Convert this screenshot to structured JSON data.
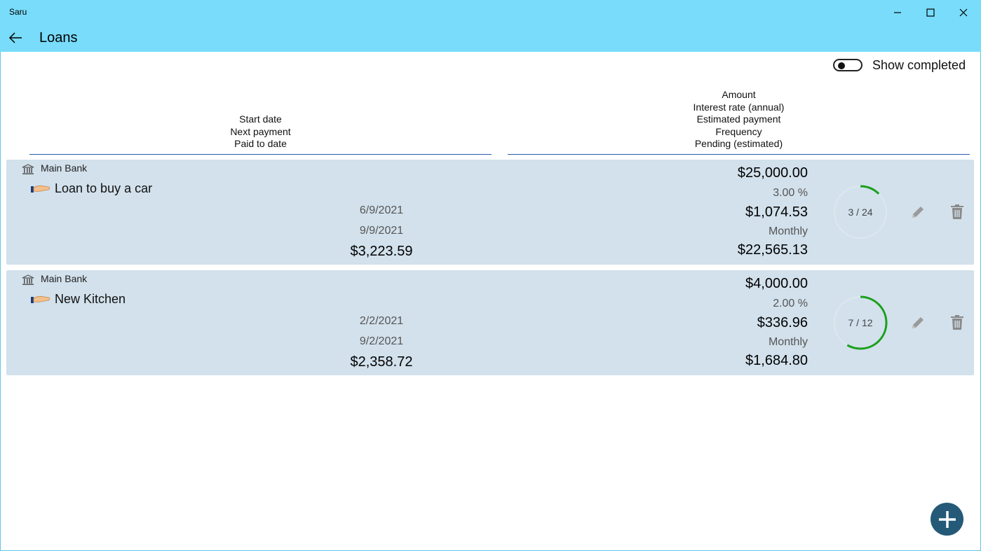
{
  "window": {
    "app_title": "Saru",
    "page_title": "Loans"
  },
  "filters": {
    "show_completed_label": "Show completed",
    "show_completed": false
  },
  "headers": {
    "left": [
      "Start date",
      "Next payment",
      "Paid to date"
    ],
    "right": [
      "Amount",
      "Interest rate (annual)",
      "Estimated payment",
      "Frequency",
      "Pending (estimated)"
    ]
  },
  "loans": [
    {
      "bank": "Main Bank",
      "name": "Loan to buy a car",
      "start_date": "6/9/2021",
      "next_payment": "9/9/2021",
      "paid_to_date": "$3,223.59",
      "amount": "$25,000.00",
      "interest_rate": "3.00 %",
      "estimated_payment": "$1,074.53",
      "frequency": "Monthly",
      "pending": "$22,565.13",
      "progress_label": "3 / 24",
      "progress": 0.125
    },
    {
      "bank": "Main Bank",
      "name": "New Kitchen",
      "start_date": "2/2/2021",
      "next_payment": "9/2/2021",
      "paid_to_date": "$2,358.72",
      "amount": "$4,000.00",
      "interest_rate": "2.00 %",
      "estimated_payment": "$336.96",
      "frequency": "Monthly",
      "pending": "$1,684.80",
      "progress_label": "7 / 12",
      "progress": 0.5833
    }
  ],
  "icons": {
    "back": "arrow-left-icon",
    "minimize": "minimize-icon",
    "maximize": "maximize-icon",
    "close": "close-icon",
    "bank": "bank-icon",
    "loan": "handshake-icon",
    "edit": "pencil-icon",
    "delete": "trash-icon",
    "add": "plus-icon"
  },
  "colors": {
    "titlebar": "#78dcfa",
    "card_bg": "#d2e1ec",
    "progress": "#1aa01a",
    "progress_track": "#dde8ee",
    "fab": "#245a78",
    "header_rule": "#2a5fa8"
  }
}
